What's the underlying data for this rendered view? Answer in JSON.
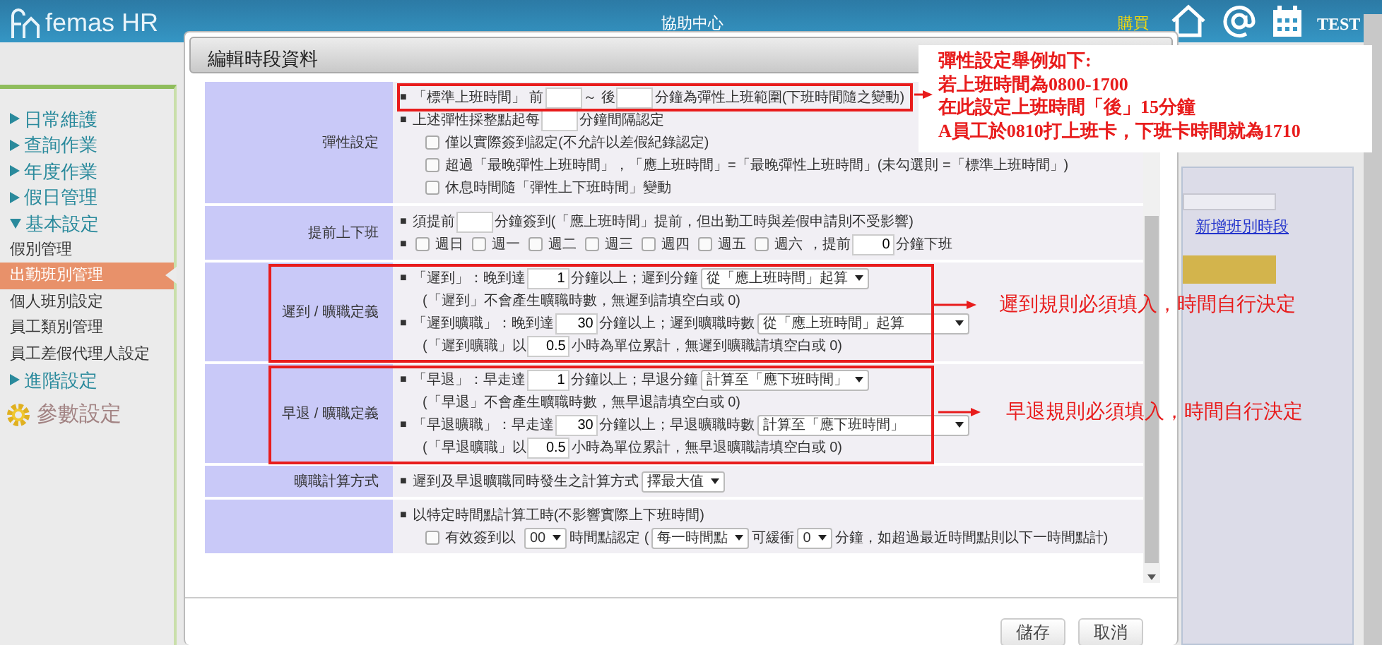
{
  "topbar": {
    "logo": "femas HR",
    "center": "協助中心",
    "buy": "購買",
    "user": "TEST"
  },
  "sidebar": {
    "items": [
      {
        "label": "日常維護",
        "kind": "section",
        "expanded": false
      },
      {
        "label": "查詢作業",
        "kind": "section",
        "expanded": false
      },
      {
        "label": "年度作業",
        "kind": "section",
        "expanded": false
      },
      {
        "label": "假日管理",
        "kind": "section",
        "expanded": false
      },
      {
        "label": "基本設定",
        "kind": "section",
        "expanded": true,
        "children": [
          {
            "label": "假別管理",
            "selected": false
          },
          {
            "label": "出勤班別管理",
            "selected": true
          },
          {
            "label": "個人班別設定",
            "selected": false
          },
          {
            "label": "員工類別管理",
            "selected": false
          },
          {
            "label": "員工差假代理人設定",
            "selected": false
          }
        ]
      },
      {
        "label": "進階設定",
        "kind": "section",
        "expanded": false
      },
      {
        "label": "參數設定",
        "kind": "settings"
      }
    ]
  },
  "background_panel": {
    "link": "新增班別時段"
  },
  "modal": {
    "title": "編輯時段資料",
    "rows": [
      {
        "label": "彈性設定",
        "lines": [
          {
            "highlighted": true,
            "parts": [
              {
                "kind": "bullet",
                "text": "■"
              },
              {
                "kind": "text",
                "text": "「標準上班時間」 前"
              },
              {
                "kind": "input"
              },
              {
                "kind": "text",
                "text": "～ 後"
              },
              {
                "kind": "input"
              },
              {
                "kind": "text",
                "text": "分鐘為彈性上班範圍(下班時間隨之變動)"
              }
            ]
          },
          {
            "parts": [
              {
                "kind": "bullet",
                "text": "■"
              },
              {
                "kind": "text",
                "text": "上述彈性採整點起每"
              },
              {
                "kind": "input"
              },
              {
                "kind": "text",
                "text": "分鐘間隔認定"
              }
            ]
          },
          {
            "indent": true,
            "parts": [
              {
                "kind": "checkbox",
                "checked": false,
                "label": "僅以實際簽到認定(不允許以差假紀錄認定)"
              }
            ]
          },
          {
            "indent": true,
            "parts": [
              {
                "kind": "checkbox",
                "checked": false,
                "label": "超過「最晚彈性上班時間」，「應上班時間」=「最晚彈性上班時間」(未勾選則 =「標準上班時間」)"
              }
            ]
          },
          {
            "indent": true,
            "parts": [
              {
                "kind": "checkbox",
                "checked": false,
                "label": "休息時間隨「彈性上下班時間」變動"
              }
            ]
          }
        ]
      },
      {
        "label": "提前上下班",
        "lines": [
          {
            "parts": [
              {
                "kind": "bullet",
                "text": "■"
              },
              {
                "kind": "text",
                "text": "須提前"
              },
              {
                "kind": "input"
              },
              {
                "kind": "text",
                "text": "分鐘簽到(「應上班時間」提前，但出勤工時與差假申請則不受影響)"
              }
            ]
          },
          {
            "parts": [
              {
                "kind": "bullet",
                "text": "■"
              },
              {
                "kind": "checkbox",
                "checked": false,
                "label": "週日"
              },
              {
                "kind": "checkbox",
                "checked": false,
                "label": "週一"
              },
              {
                "kind": "checkbox",
                "checked": false,
                "label": "週二"
              },
              {
                "kind": "checkbox",
                "checked": false,
                "label": "週三"
              },
              {
                "kind": "checkbox",
                "checked": false,
                "label": "週四"
              },
              {
                "kind": "checkbox",
                "checked": false,
                "label": "週五"
              },
              {
                "kind": "checkbox",
                "checked": false,
                "label": "週六"
              },
              {
                "kind": "text",
                "text": "，提前"
              },
              {
                "kind": "input",
                "value": "0"
              },
              {
                "kind": "text",
                "text": "分鐘下班"
              }
            ]
          }
        ]
      },
      {
        "label": "遲到 / 曠職定義",
        "highlighted": true,
        "lines": [
          {
            "parts": [
              {
                "kind": "bullet",
                "text": "■"
              },
              {
                "kind": "text",
                "text": "「遲到」：晚到達"
              },
              {
                "kind": "input",
                "value": "1"
              },
              {
                "kind": "text",
                "text": "分鐘以上；遲到分鐘"
              },
              {
                "kind": "select",
                "value": "從「應上班時間」起算"
              }
            ]
          },
          {
            "indent": true,
            "parts": [
              {
                "kind": "text",
                "text": "(「遲到」不會產生曠職時數，無遲到請填空白或 0)"
              }
            ]
          },
          {
            "parts": [
              {
                "kind": "bullet",
                "text": "■"
              },
              {
                "kind": "text",
                "text": "「遲到曠職」：晚到達"
              },
              {
                "kind": "input",
                "value": "30"
              },
              {
                "kind": "text",
                "text": "分鐘以上；遲到曠職時數"
              },
              {
                "kind": "select",
                "value": "從「應上班時間」起算",
                "wide": true
              }
            ]
          },
          {
            "indent": true,
            "parts": [
              {
                "kind": "text",
                "text": "(「遲到曠職」以"
              },
              {
                "kind": "input",
                "value": "0.5"
              },
              {
                "kind": "text",
                "text": "小時為單位累計，無遲到曠職請填空白或 0)"
              }
            ]
          }
        ]
      },
      {
        "label": "早退 / 曠職定義",
        "highlighted": true,
        "lines": [
          {
            "parts": [
              {
                "kind": "bullet",
                "text": "■"
              },
              {
                "kind": "text",
                "text": "「早退」：早走達"
              },
              {
                "kind": "input",
                "value": "1"
              },
              {
                "kind": "text",
                "text": "分鐘以上；早退分鐘"
              },
              {
                "kind": "select",
                "value": "計算至「應下班時間」"
              }
            ]
          },
          {
            "indent": true,
            "parts": [
              {
                "kind": "text",
                "text": "(「早退」不會產生曠職時數，無早退請填空白或 0)"
              }
            ]
          },
          {
            "parts": [
              {
                "kind": "bullet",
                "text": "■"
              },
              {
                "kind": "text",
                "text": "「早退曠職」：早走達"
              },
              {
                "kind": "input",
                "value": "30"
              },
              {
                "kind": "text",
                "text": "分鐘以上；早退曠職時數"
              },
              {
                "kind": "select",
                "value": "計算至「應下班時間」",
                "wide": true
              }
            ]
          },
          {
            "indent": true,
            "parts": [
              {
                "kind": "text",
                "text": "(「早退曠職」以"
              },
              {
                "kind": "input",
                "value": "0.5"
              },
              {
                "kind": "text",
                "text": "小時為單位累計，無早退曠職請填空白或 0)"
              }
            ]
          }
        ]
      },
      {
        "label": "曠職計算方式",
        "lines": [
          {
            "parts": [
              {
                "kind": "bullet",
                "text": "■"
              },
              {
                "kind": "text",
                "text": "遲到及早退曠職同時發生之計算方式"
              },
              {
                "kind": "select",
                "value": "擇最大值"
              }
            ]
          }
        ]
      },
      {
        "lines": [
          {
            "parts": [
              {
                "kind": "bullet",
                "text": "■"
              },
              {
                "kind": "text",
                "text": "以特定時間點計算工時(不影響實際上下班時間)"
              }
            ]
          },
          {
            "indent": true,
            "parts": [
              {
                "kind": "checkbox",
                "checked": false,
                "label": "有效簽到以"
              },
              {
                "kind": "select",
                "value": "00"
              },
              {
                "kind": "text",
                "text": "時間點認定 ("
              },
              {
                "kind": "select",
                "value": "每一時間點"
              },
              {
                "kind": "text",
                "text": "可緩衝"
              },
              {
                "kind": "select",
                "value": "0"
              },
              {
                "kind": "text",
                "text": "分鐘，如超過最近時間點則以下一時間點計)"
              }
            ]
          }
        ]
      }
    ],
    "buttons": [
      "儲存",
      "取消"
    ]
  },
  "annotations": {
    "callout": [
      "彈性設定舉例如下:",
      "若上班時間為0800-1700",
      "在此設定上班時間「後」15分鐘",
      "A員工於0810打上班卡，下班卡時間就為1710"
    ],
    "notes": [
      "遲到規則必須填入，時間自行決定",
      "早退規則必須填入，時間自行決定"
    ]
  }
}
